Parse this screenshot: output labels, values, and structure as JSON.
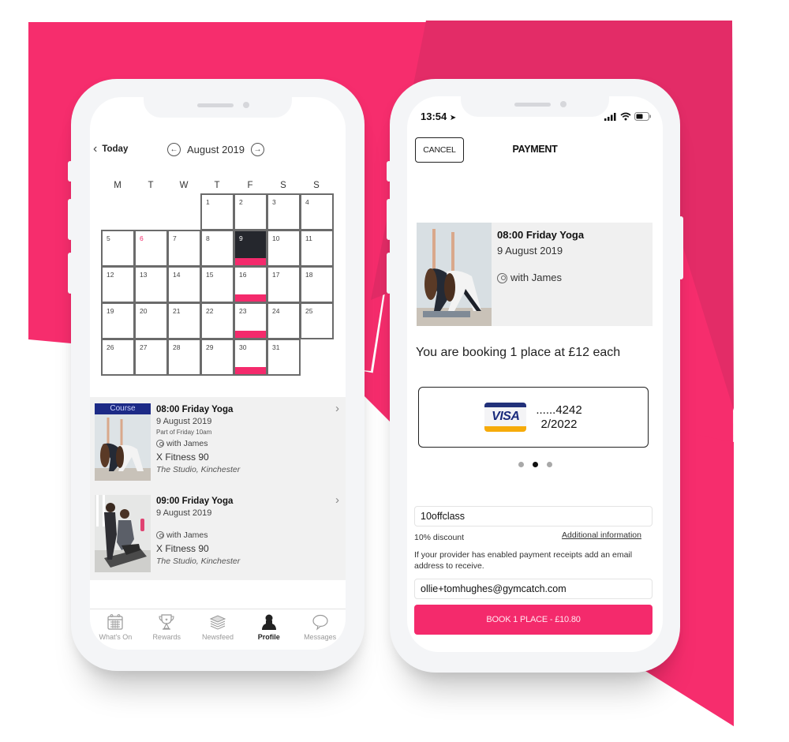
{
  "colors": {
    "brand_pink": "#f42a6c",
    "background_pink": "#f62d6d",
    "background_pink_dark": "#e32c67",
    "course_badge": "#1c2a86",
    "selected_day": "#25272d",
    "visa_blue": "#22317a",
    "visa_gold": "#f6ab0a"
  },
  "calendar_screen": {
    "today_label": "Today",
    "month_label": "August 2019",
    "prev_month_icon": "arrow-left-circle-icon",
    "next_month_icon": "arrow-right-circle-icon",
    "weekdays": [
      "M",
      "T",
      "W",
      "T",
      "F",
      "S",
      "S"
    ],
    "leading_empty_days": 3,
    "days": [
      {
        "n": "1"
      },
      {
        "n": "2"
      },
      {
        "n": "3"
      },
      {
        "n": "4"
      },
      {
        "n": "5"
      },
      {
        "n": "6",
        "today": true
      },
      {
        "n": "7"
      },
      {
        "n": "8"
      },
      {
        "n": "9",
        "selected": true,
        "event": true
      },
      {
        "n": "10"
      },
      {
        "n": "11"
      },
      {
        "n": "12"
      },
      {
        "n": "13"
      },
      {
        "n": "14"
      },
      {
        "n": "15"
      },
      {
        "n": "16",
        "event": true
      },
      {
        "n": "17"
      },
      {
        "n": "18"
      },
      {
        "n": "19"
      },
      {
        "n": "20"
      },
      {
        "n": "21"
      },
      {
        "n": "22"
      },
      {
        "n": "23",
        "event": true
      },
      {
        "n": "24"
      },
      {
        "n": "25"
      },
      {
        "n": "26"
      },
      {
        "n": "27"
      },
      {
        "n": "28"
      },
      {
        "n": "29"
      },
      {
        "n": "30",
        "event": true
      },
      {
        "n": "31"
      }
    ],
    "events": [
      {
        "badge": "Course",
        "title": "08:00 Friday Yoga",
        "date": "9 August 2019",
        "subtitle": "Part of Friday 10am",
        "instructor": "with James",
        "venue": "X Fitness 90",
        "location": "The Studio, Kinchester"
      },
      {
        "badge": "",
        "title": "09:00 Friday Yoga",
        "date": "9 August 2019",
        "subtitle": "",
        "instructor": "with James",
        "venue": "X Fitness 90",
        "location": "The Studio, Kinchester"
      }
    ],
    "tabbar": [
      {
        "label": "What's On",
        "icon": "calendar-icon",
        "active": false
      },
      {
        "label": "Rewards",
        "icon": "trophy-icon",
        "active": false
      },
      {
        "label": "Newsfeed",
        "icon": "layers-icon",
        "active": false
      },
      {
        "label": "Profile",
        "icon": "person-icon",
        "active": true
      },
      {
        "label": "Messages",
        "icon": "speech-bubble-icon",
        "active": false
      }
    ]
  },
  "payment_screen": {
    "status_time": "13:54",
    "cancel_label": "CANCEL",
    "title": "PAYMENT",
    "booking": {
      "title": "08:00 Friday Yoga",
      "date": "9 August 2019",
      "instructor": "with James"
    },
    "booking_text": "You are booking 1 place at £12 each",
    "card": {
      "brand": "VISA",
      "number": "......4242",
      "expiry": "2/2022"
    },
    "carousel": {
      "count": 3,
      "active_index": 1
    },
    "promo_code_value": "10offclass",
    "discount_text": "10% discount",
    "additional_info_link": "Additional information",
    "receipt_note": "If your provider has enabled payment receipts add an email address to receive.",
    "email_value": "ollie+tomhughes@gymcatch.com",
    "book_button_label": "BOOK 1 PLACE - £10.80"
  }
}
